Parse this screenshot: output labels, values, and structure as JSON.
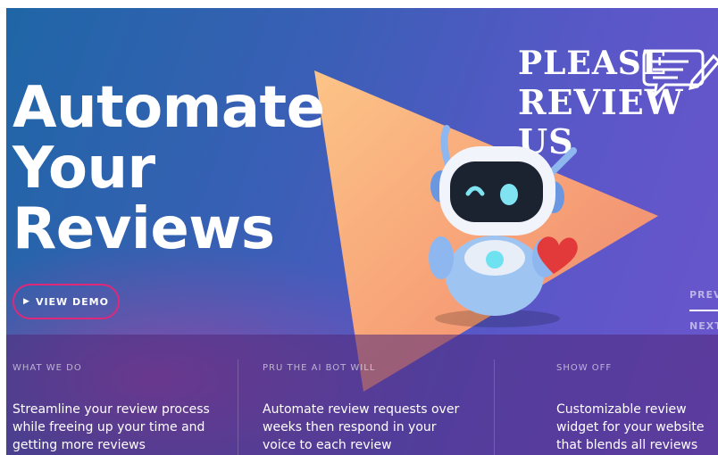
{
  "hero": {
    "headline_line1": "Automate",
    "headline_line2": "Your",
    "headline_line3": "Reviews",
    "cta_icon": "play-icon",
    "cta_label": "VIEW DEMO"
  },
  "promo_badge": {
    "line1": "PLEASE",
    "line2": "REVIEW US",
    "icon": "speech-bubble-pen-icon"
  },
  "side_nav": {
    "prev_label": "PREV",
    "next_label": "NEXT"
  },
  "features": [
    {
      "label": "WHAT WE DO",
      "text": "Streamline your review process while freeing up your time and getting more reviews"
    },
    {
      "label": "PRU THE AI BOT WILL",
      "text": "Automate review requests over weeks then respond in your voice to each review"
    },
    {
      "label": "SHOW OFF",
      "text": "Customizable review widget for your website that blends all reviews"
    }
  ],
  "colors": {
    "accent": "#e0287a",
    "hero_blue": "#1f66a6",
    "hero_purple": "#6b55cc",
    "triangle": "#f7a077"
  }
}
